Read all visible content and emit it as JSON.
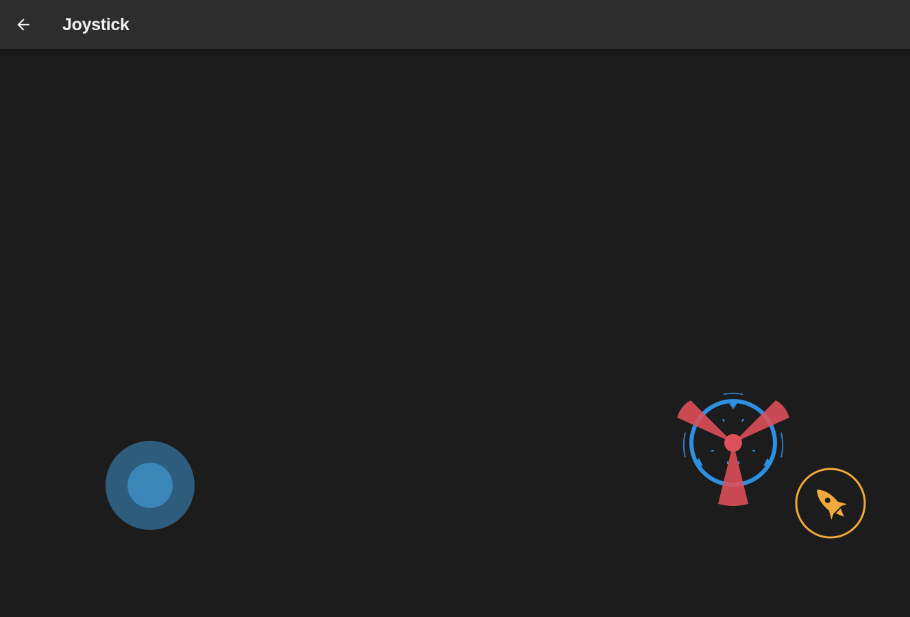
{
  "app_bar": {
    "title": "Joystick",
    "back_icon": "arrow-back-icon"
  },
  "controls": {
    "joystick_icon": "joystick-thumb",
    "crosshair_icon": "crosshair-icon",
    "fire_icon": "rocket-icon"
  },
  "colors": {
    "app_bar": "#2d2d2d",
    "background": "#1c1c1c",
    "joystick_base": "#2e5c7c",
    "joystick_knob": "#3b86b8",
    "crosshair_ring": "#2f8fe0",
    "crosshair_blades": "#e0505a",
    "fire_button": "#f2a93b"
  }
}
